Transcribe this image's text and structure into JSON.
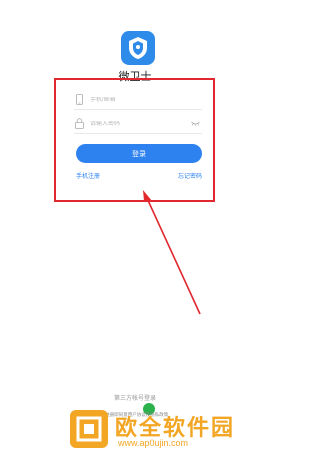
{
  "app": {
    "name": "微卫士"
  },
  "login": {
    "phone_placeholder": "手机/邮箱",
    "password_placeholder": "请输入密码",
    "login_button": "登录",
    "register_link": "手机注册",
    "forgot_link": "忘记密码"
  },
  "footer": {
    "third_party_label": "第三方帐号登录",
    "agreement_text": "手机登录 注册即同意用户协议及隐私政策"
  },
  "watermark": {
    "title": "欧全软件园",
    "url": "www.ap0ujin.com"
  },
  "colors": {
    "accent": "#2d82f0",
    "highlight": "#e0282e",
    "watermark": "#f2a624"
  }
}
